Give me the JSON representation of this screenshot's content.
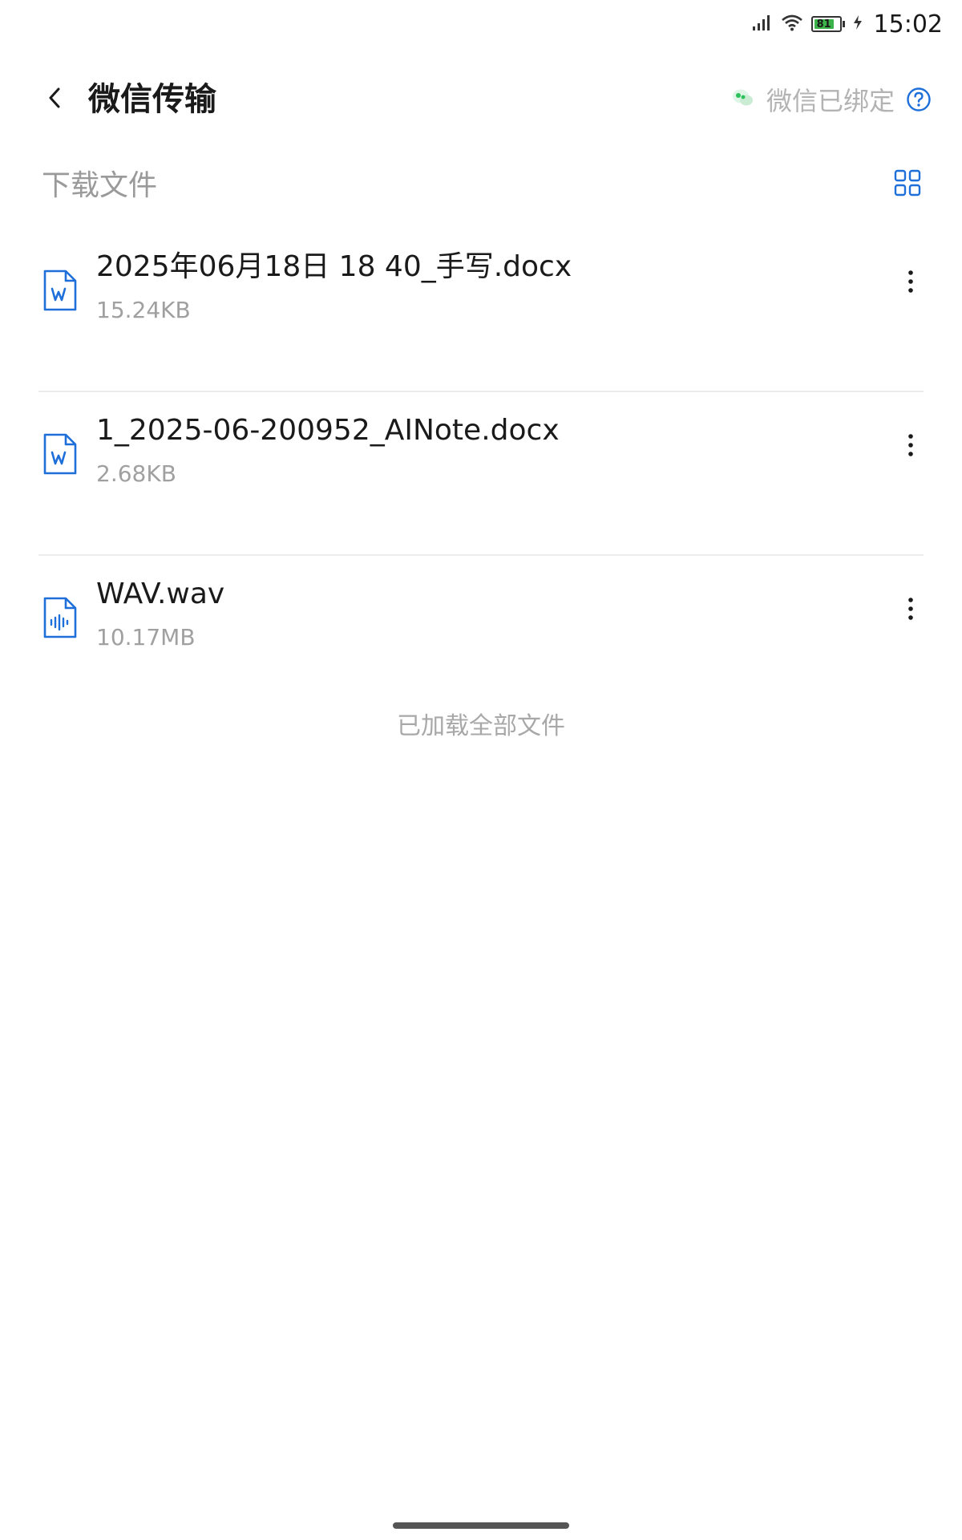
{
  "status_bar": {
    "time": "15:02",
    "battery_level": "81",
    "battery_fraction": 0.81,
    "icons": [
      "signal-icon",
      "wifi-icon",
      "battery-icon",
      "charging-icon"
    ]
  },
  "header": {
    "title": "微信传输",
    "bind_status_text": "微信已绑定",
    "icons": [
      "back-arrow-icon",
      "wechat-icon",
      "help-icon"
    ]
  },
  "section": {
    "title": "下载文件",
    "view_toggle_icon": "grid-view-icon"
  },
  "files": [
    {
      "name": "2025年06月18日 18 40_手写.docx",
      "size": "15.24KB",
      "icon": "word-document-icon"
    },
    {
      "name": "1_2025-06-200952_AINote.docx",
      "size": "2.68KB",
      "icon": "word-document-icon"
    },
    {
      "name": "WAV.wav",
      "size": "10.17MB",
      "icon": "audio-file-icon"
    }
  ],
  "footer": {
    "loaded_all_text": "已加载全部文件"
  },
  "colors": {
    "accent": "#1e6fd9",
    "wechat_green": "#2bc15a",
    "battery_green": "#3bb34a",
    "muted_text": "#a0a0a0"
  }
}
